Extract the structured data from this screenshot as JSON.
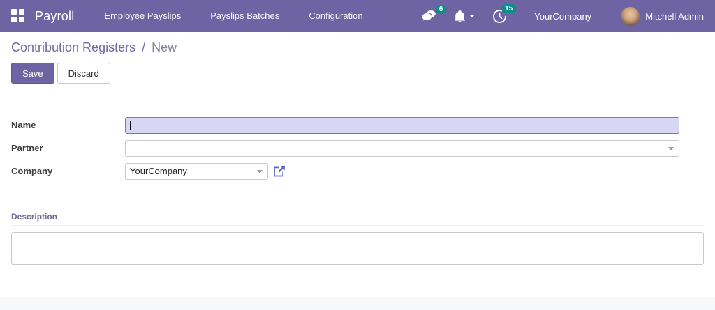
{
  "navbar": {
    "brand": "Payroll",
    "menu_items": [
      "Employee Payslips",
      "Payslips Batches",
      "Configuration"
    ],
    "systray": {
      "messages_badge": "6",
      "activities_badge": "15",
      "company": "YourCompany",
      "user": "Mitchell Admin"
    }
  },
  "breadcrumb": {
    "parent": "Contribution Registers",
    "separator": "/",
    "current": "New"
  },
  "actions": {
    "save": "Save",
    "discard": "Discard"
  },
  "form": {
    "fields": [
      {
        "label": "Name",
        "value": ""
      },
      {
        "label": "Partner",
        "value": ""
      },
      {
        "label": "Company",
        "value": "YourCompany"
      }
    ],
    "description": {
      "label": "Description",
      "value": ""
    }
  },
  "colors": {
    "navbar_bg": "#6e63a3",
    "badge_bg": "#0e8c89",
    "save_button_bg": "#6e63a3",
    "focused_input_bg": "#d8d7f3",
    "focused_input_border": "#7a78bd",
    "breadcrumb_link": "#6e6aa4",
    "external_link_icon": "#5a67c4"
  }
}
